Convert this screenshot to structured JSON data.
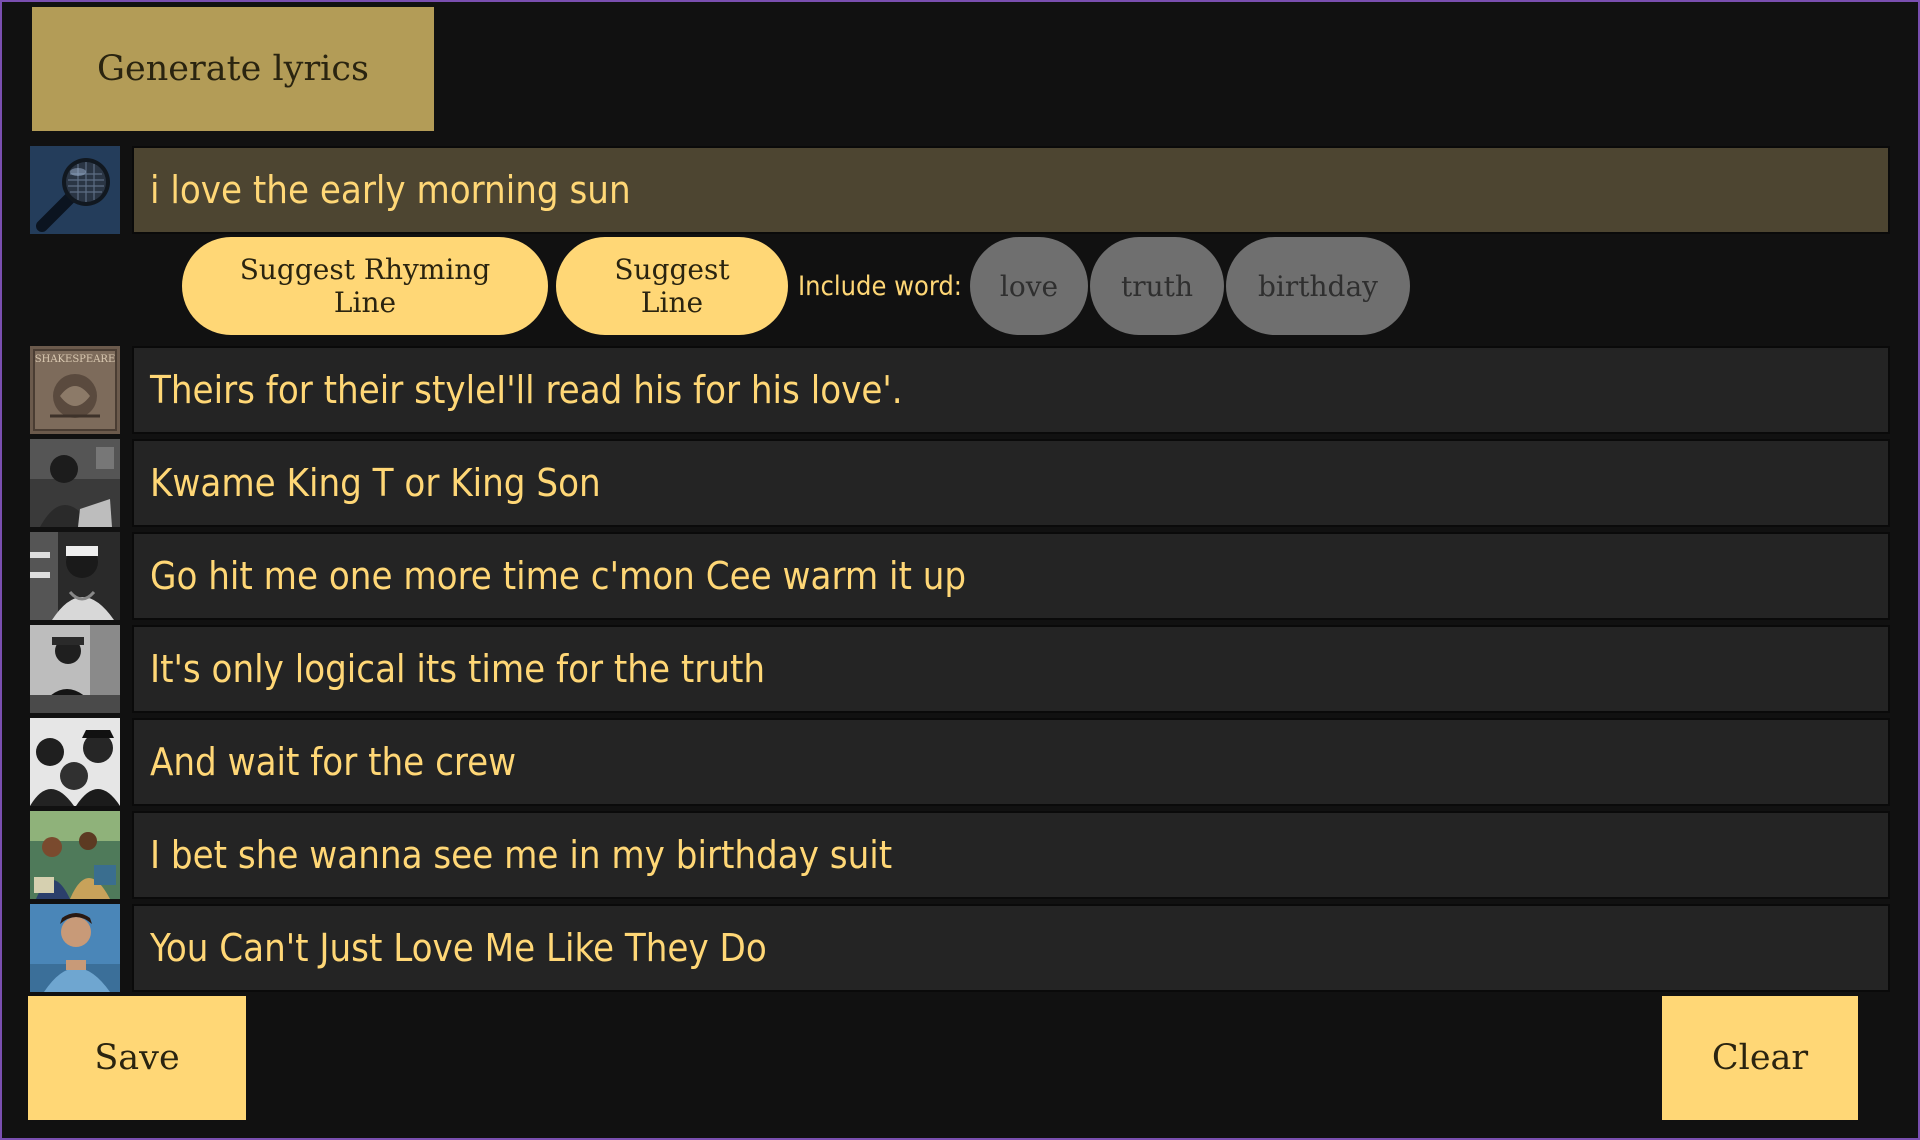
{
  "toolbar": {
    "generate_label": "Generate lyrics"
  },
  "input": {
    "value": "i love the early morning sun",
    "avatar_icon": "microphone-icon"
  },
  "suggest": {
    "rhyming_label": "Suggest Rhyming Line",
    "line_label": "Suggest Line",
    "include_label": "Include word:",
    "words": [
      "love",
      "truth",
      "birthday"
    ]
  },
  "lines": [
    {
      "text": "Theirs for their styleI'll read his for his love'.",
      "avatar": "shakespeare-book-cover"
    },
    {
      "text": "Kwame King T or King Son",
      "avatar": "artist-photo"
    },
    {
      "text": "Go hit me one more time c'mon Cee warm it up",
      "avatar": "artist-photo"
    },
    {
      "text": "It's only logical its time for the truth",
      "avatar": "artist-photo"
    },
    {
      "text": "And wait for the crew",
      "avatar": "group-photo"
    },
    {
      "text": "I bet she wanna see me in my birthday suit",
      "avatar": "colorful-group-photo"
    },
    {
      "text": "You Can't Just Love Me Like They Do",
      "avatar": "artist-photo"
    }
  ],
  "footer": {
    "save_label": "Save",
    "clear_label": "Clear"
  },
  "colors": {
    "background": "#111111",
    "accent_yellow": "#ffd776",
    "accent_gold": "#b39c57",
    "row_bg": "#242424",
    "input_bg": "#4d4531",
    "chip_gray": "#6f6f6f"
  }
}
